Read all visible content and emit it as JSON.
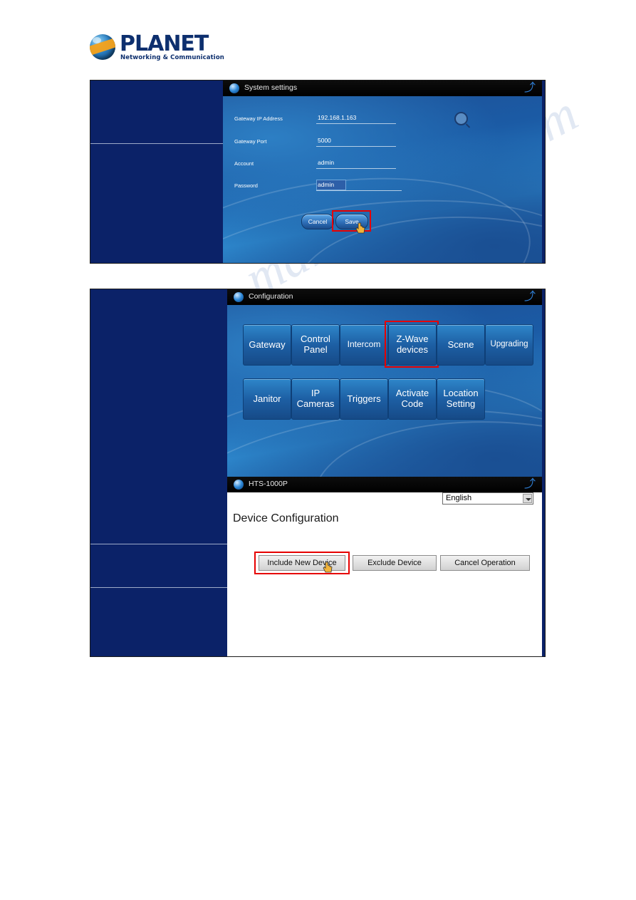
{
  "page": {
    "watermark": "manualshive.com",
    "logo": {
      "brand": "PLANET",
      "tagline": "Networking & Communication",
      "icon": "planet-globe-logo"
    }
  },
  "figure_1": {
    "window": {
      "title": "System settings",
      "back_icon": "back-arrow-icon",
      "orb_icon": "planet-orb-icon"
    },
    "form": {
      "fields": [
        {
          "label": "Gateway IP Address",
          "value": "192.168.1.163"
        },
        {
          "label": "Gateway Port",
          "value": "5000"
        },
        {
          "label": "Account",
          "value": "admin"
        },
        {
          "label": "Password",
          "value": "admin"
        }
      ],
      "search_icon": "magnifier-icon"
    },
    "buttons": {
      "cancel": "Cancel",
      "save": "Save"
    },
    "annotation": {
      "highlight_target": "Save",
      "cursor_icon": "hand-pointer-icon",
      "highlight_color": "#e60000"
    }
  },
  "figure_2": {
    "window": {
      "title": "Configuration",
      "back_icon": "back-arrow-icon",
      "orb_icon": "planet-orb-icon"
    },
    "tiles": [
      {
        "label": "Gateway"
      },
      {
        "label": "Control\nPanel"
      },
      {
        "label": "Intercom"
      },
      {
        "label": "Z-Wave\ndevices",
        "highlighted": true
      },
      {
        "label": "Scene"
      },
      {
        "label": "Upgrading"
      },
      {
        "label": "Janitor"
      },
      {
        "label": "IP\nCameras"
      },
      {
        "label": "Triggers"
      },
      {
        "label": "Activate\nCode"
      },
      {
        "label": "Location\nSetting"
      }
    ],
    "lower_window": {
      "title": "HTS-1000P",
      "back_icon": "back-arrow-icon",
      "orb_icon": "planet-orb-icon",
      "language_selected": "English",
      "heading": "Device Configuration",
      "buttons": [
        {
          "label": "Include New Device",
          "highlighted": true
        },
        {
          "label": "Exclude Device",
          "highlighted": false
        },
        {
          "label": "Cancel Operation",
          "highlighted": false
        }
      ],
      "cursor_icon": "hand-pointer-icon",
      "highlight_color": "#e60000"
    }
  }
}
